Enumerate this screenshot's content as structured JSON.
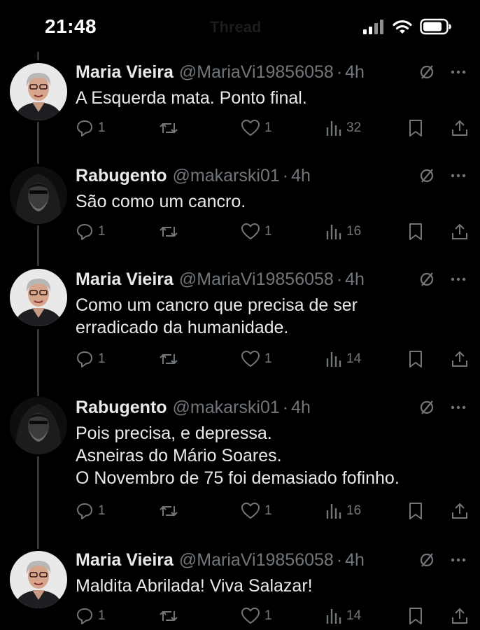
{
  "status_bar": {
    "time": "21:48",
    "title": "Thread",
    "icons": [
      "signal-icon",
      "wifi-icon",
      "battery-icon"
    ]
  },
  "colors": {
    "background": "#000000",
    "text": "#e7e9ea",
    "muted": "#71767b",
    "thread_line": "#333639"
  },
  "tweets": [
    {
      "name": "Maria Vieira",
      "handle": "@MariaVi19856058",
      "time": "4h",
      "avatar": "woman-glasses-avatar",
      "lines": [
        "A Esquerda mata. Ponto final."
      ],
      "stats": {
        "replies": "1",
        "retweets": "",
        "likes": "1",
        "views": "32"
      }
    },
    {
      "name": "Rabugento",
      "handle": "@makarski01",
      "time": "4h",
      "avatar": "hooded-figure-avatar",
      "lines": [
        "São como um cancro."
      ],
      "stats": {
        "replies": "1",
        "retweets": "",
        "likes": "1",
        "views": "16"
      }
    },
    {
      "name": "Maria Vieira",
      "handle": "@MariaVi19856058",
      "time": "4h",
      "avatar": "woman-glasses-avatar",
      "lines": [
        "Como um cancro que precisa de ser",
        "erradicado da humanidade."
      ],
      "stats": {
        "replies": "1",
        "retweets": "",
        "likes": "1",
        "views": "14"
      }
    },
    {
      "name": "Rabugento",
      "handle": "@makarski01",
      "time": "4h",
      "avatar": "hooded-figure-avatar",
      "lines": [
        "Pois precisa, e depressa.",
        "Asneiras do Mário Soares.",
        "O Novembro de 75 foi demasiado fofinho."
      ],
      "stats": {
        "replies": "1",
        "retweets": "",
        "likes": "1",
        "views": "16"
      }
    },
    {
      "name": "Maria Vieira",
      "handle": "@MariaVi19856058",
      "time": "4h",
      "avatar": "woman-glasses-avatar",
      "lines": [
        "Maldita Abrilada! Viva Salazar!"
      ],
      "stats": {
        "replies": "1",
        "retweets": "",
        "likes": "1",
        "views": "14"
      }
    }
  ]
}
